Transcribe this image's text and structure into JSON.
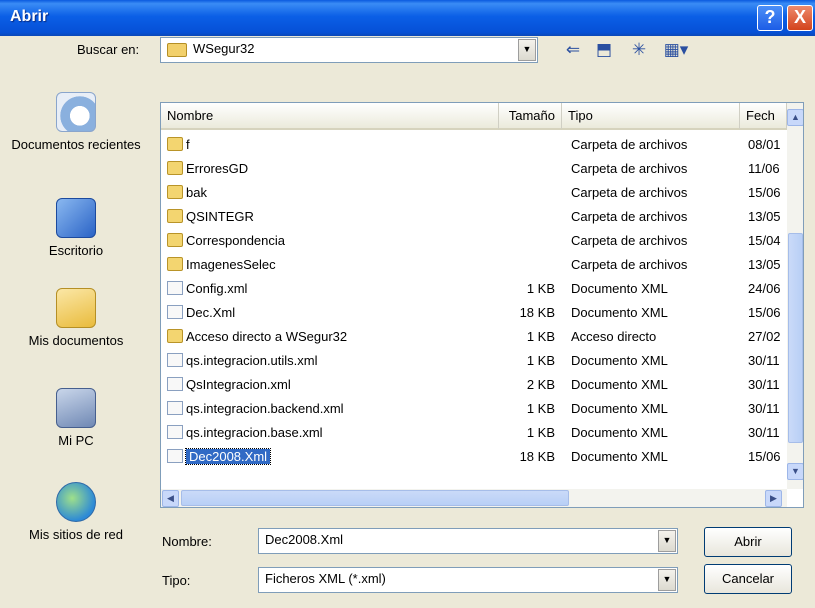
{
  "window": {
    "title": "Abrir"
  },
  "titlebar": {
    "help_label": "?",
    "close_label": "X"
  },
  "lookin": {
    "label": "Buscar en:",
    "value": "WSegur32"
  },
  "places": [
    {
      "label": "Documentos recientes",
      "icon": "recent-documents-icon"
    },
    {
      "label": "Escritorio",
      "icon": "desktop-icon"
    },
    {
      "label": "Mis documentos",
      "icon": "my-documents-icon"
    },
    {
      "label": "Mi PC",
      "icon": "my-computer-icon"
    },
    {
      "label": "Mis sitios de red",
      "icon": "network-places-icon"
    }
  ],
  "columns": {
    "name": "Nombre",
    "size": "Tamaño",
    "type": "Tipo",
    "date": "Fech"
  },
  "files": [
    {
      "name": "f",
      "size": "",
      "type": "Carpeta de archivos",
      "date": "08/01",
      "kind": "folder"
    },
    {
      "name": "ErroresGD",
      "size": "",
      "type": "Carpeta de archivos",
      "date": "11/06",
      "kind": "folder"
    },
    {
      "name": "bak",
      "size": "",
      "type": "Carpeta de archivos",
      "date": "15/06",
      "kind": "folder"
    },
    {
      "name": "QSINTEGR",
      "size": "",
      "type": "Carpeta de archivos",
      "date": "13/05",
      "kind": "folder"
    },
    {
      "name": "Correspondencia",
      "size": "",
      "type": "Carpeta de archivos",
      "date": "15/04",
      "kind": "folder"
    },
    {
      "name": "ImagenesSelec",
      "size": "",
      "type": "Carpeta de archivos",
      "date": "13/05",
      "kind": "folder"
    },
    {
      "name": "Config.xml",
      "size": "1 KB",
      "type": "Documento XML",
      "date": "24/06",
      "kind": "xml"
    },
    {
      "name": "Dec.Xml",
      "size": "18 KB",
      "type": "Documento XML",
      "date": "15/06",
      "kind": "xml"
    },
    {
      "name": "Acceso directo a WSegur32",
      "size": "1 KB",
      "type": "Acceso directo",
      "date": "27/02",
      "kind": "shortcut"
    },
    {
      "name": "qs.integracion.utils.xml",
      "size": "1 KB",
      "type": "Documento XML",
      "date": "30/11",
      "kind": "xml"
    },
    {
      "name": "QsIntegracion.xml",
      "size": "2 KB",
      "type": "Documento XML",
      "date": "30/11",
      "kind": "xml"
    },
    {
      "name": "qs.integracion.backend.xml",
      "size": "1 KB",
      "type": "Documento XML",
      "date": "30/11",
      "kind": "xml"
    },
    {
      "name": "qs.integracion.base.xml",
      "size": "1 KB",
      "type": "Documento XML",
      "date": "30/11",
      "kind": "xml"
    },
    {
      "name": "Dec2008.Xml",
      "size": "18 KB",
      "type": "Documento XML",
      "date": "15/06",
      "kind": "xml",
      "selected": true
    }
  ],
  "filename": {
    "label": "Nombre:",
    "value": "Dec2008.Xml"
  },
  "filetype": {
    "label": "Tipo:",
    "value": "Ficheros XML (*.xml)"
  },
  "buttons": {
    "open": "Abrir",
    "cancel": "Cancelar"
  },
  "colors": {
    "titlebar": "#0a5adf",
    "dialog_bg": "#ece9d8",
    "selection": "#316ac5"
  }
}
